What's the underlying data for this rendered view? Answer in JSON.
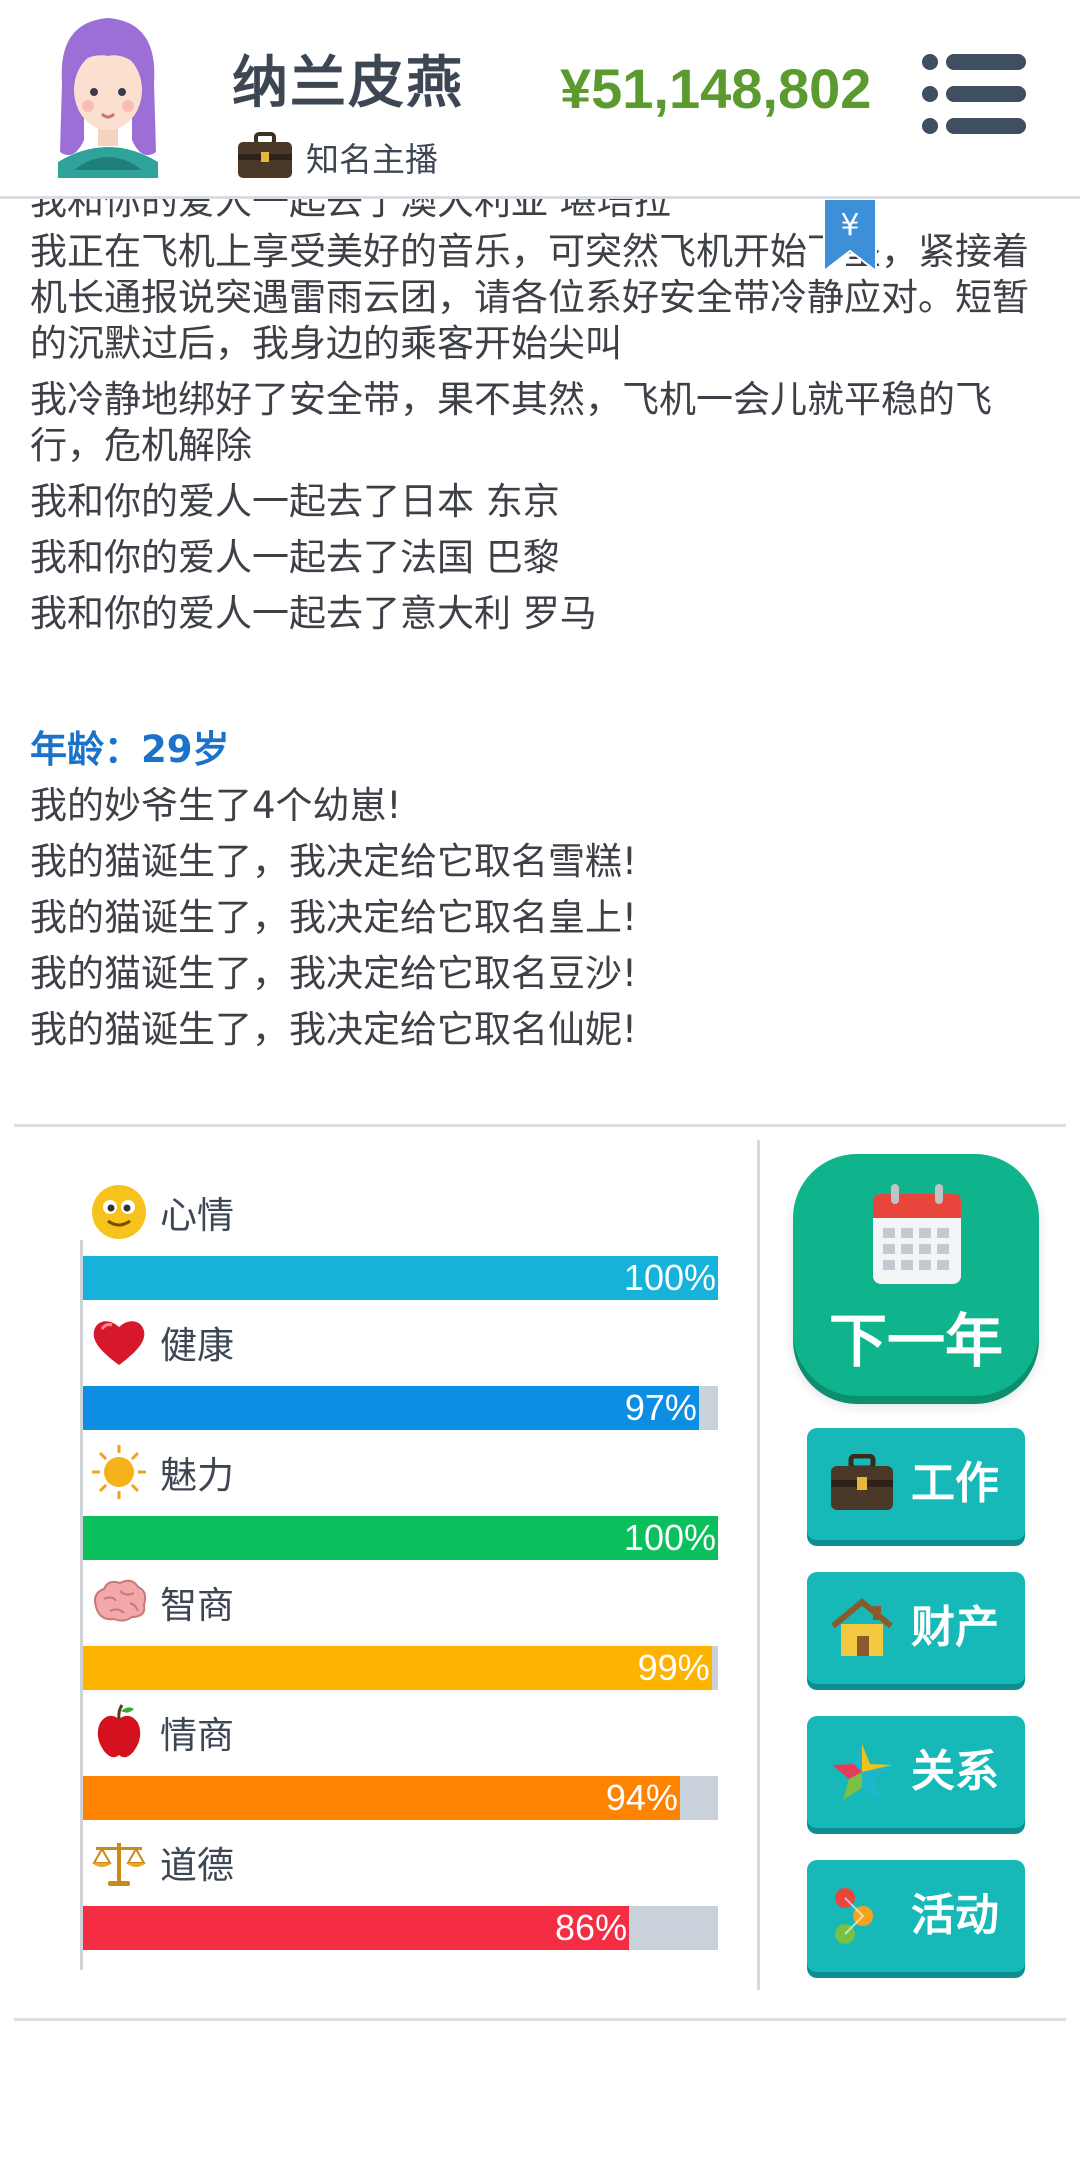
{
  "header": {
    "name": "纳兰皮燕",
    "job": "知名主播",
    "money": "¥51,148,802",
    "avatar_icon": "girl-avatar-icon",
    "job_icon": "briefcase-icon",
    "menu_icon": "menu-list-icon"
  },
  "log": {
    "cut_line": "我和你的爱人一起去了澳大利亚 堪培拉",
    "lines_a": [
      "我正在飞机上享受美好的音乐，可突然飞机开始下坠，紧接着机长通报说突遇雷雨云团，请各位系好安全带冷静应对。短暂的沉默过后，我身边的乘客开始尖叫",
      "我冷静地绑好了安全带，果不其然，飞机一会儿就平稳的飞行，危机解除",
      "我和你的爱人一起去了日本 东京",
      "我和你的爱人一起去了法国 巴黎",
      "我和你的爱人一起去了意大利 罗马"
    ],
    "age_heading": "年龄：29岁",
    "lines_b": [
      "我的妙爷生了4个幼崽!",
      "我的猫诞生了，我决定给它取名雪糕!",
      "我的猫诞生了，我决定给它取名皇上!",
      "我的猫诞生了，我决定给它取名豆沙!",
      "我的猫诞生了，我决定给它取名仙妮!"
    ],
    "bookmark_symbol": "¥"
  },
  "stats": [
    {
      "label": "心情",
      "percent": 100,
      "pct_text": "100%",
      "color": "#17b2d9",
      "icon": "smiley-face-icon"
    },
    {
      "label": "健康",
      "percent": 97,
      "pct_text": "97%",
      "color": "#0e8ee3",
      "icon": "heart-icon"
    },
    {
      "label": "魅力",
      "percent": 100,
      "pct_text": "100%",
      "color": "#0bbf5c",
      "icon": "sun-icon"
    },
    {
      "label": "智商",
      "percent": 99,
      "pct_text": "99%",
      "color": "#fcb400",
      "icon": "brain-icon"
    },
    {
      "label": "情商",
      "percent": 94,
      "pct_text": "94%",
      "color": "#fd8300",
      "icon": "apple-icon"
    },
    {
      "label": "道德",
      "percent": 86,
      "pct_text": "86%",
      "color": "#f42d43",
      "icon": "scales-icon"
    }
  ],
  "actions": {
    "next_year": "下一年",
    "work": "工作",
    "property": "财产",
    "relations": "关系",
    "activities": "活动"
  }
}
